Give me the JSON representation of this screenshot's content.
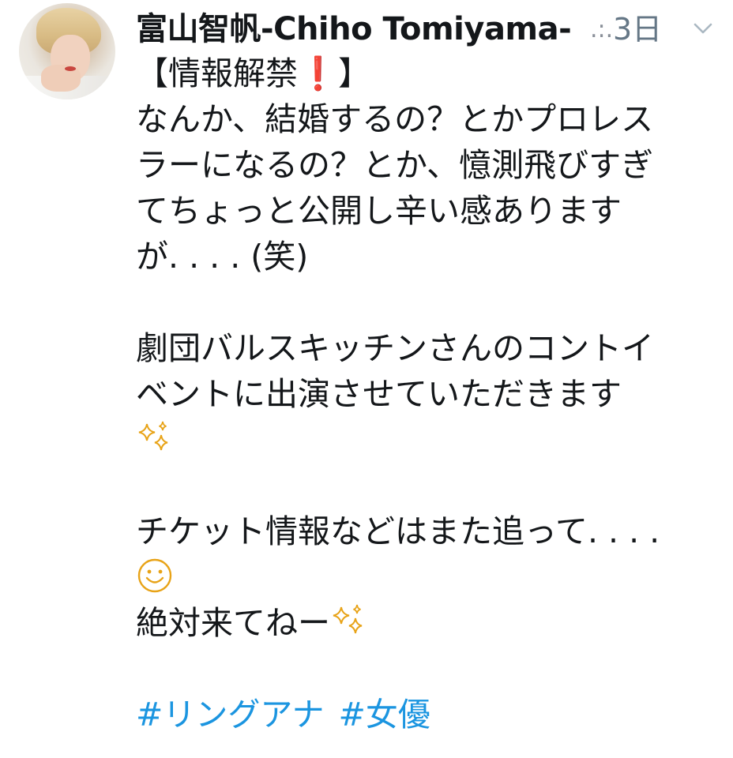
{
  "author": {
    "display_name": "富山智帆-Chiho Tomiyama-",
    "truncation": ".:.",
    "timestamp": "3日"
  },
  "tweet": {
    "line1_a": "【情報解禁",
    "line1_emoji": "❗",
    "line1_b": "】",
    "line2": "なんか、結婚するの？とかプロレス",
    "line3": "ラーになるの？とか、憶測飛びすぎ",
    "line4": "てちょっと公開し辛い感あります",
    "line5": "が. . . . (笑)",
    "line6": "劇団バルスキッチンさんのコントイ",
    "line7": "ベントに出演させていただきます",
    "line9": "チケット情報などはまた追って. . . .",
    "line11": "絶対来てねー",
    "hashtags": [
      "#リングアナ",
      "#女優"
    ]
  },
  "icons": {
    "avatar": "profile-photo",
    "menu": "chevron-down-icon",
    "sparkles": "sparkles-emoji",
    "smile": "smiling-face-emoji",
    "exclamation": "red-exclamation-emoji"
  },
  "colors": {
    "text": "#14171a",
    "muted": "#657786",
    "link": "#1b95e0",
    "emoji_red": "#e0202e",
    "emoji_gold": "#e8a317"
  }
}
